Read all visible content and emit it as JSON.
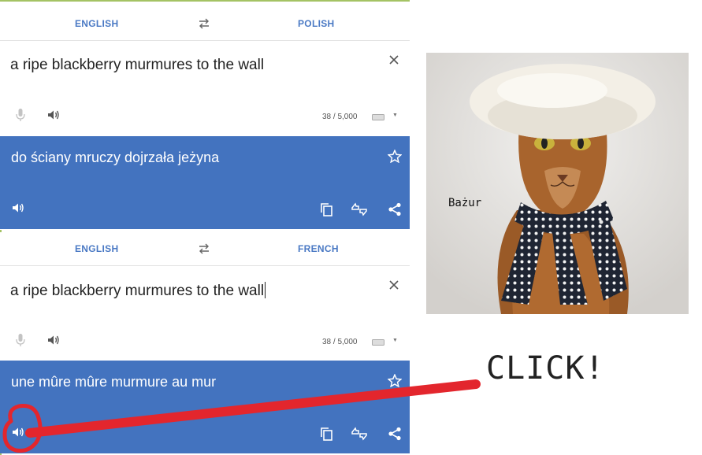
{
  "panels": [
    {
      "source_lang": "ENGLISH",
      "target_lang": "POLISH",
      "source_text": "a ripe blackberry murmures to the wall",
      "char_count": "38 / 5,000",
      "translation": "do ściany mruczy dojrzała jeżyna"
    },
    {
      "source_lang": "ENGLISH",
      "target_lang": "FRENCH",
      "source_text": "a ripe blackberry murmures to the wall",
      "char_count": "38 / 5,000",
      "translation": "une mûre mûre murmure au mur"
    }
  ],
  "photo": {
    "caption": "Bażur"
  },
  "annotation": {
    "text": "CLICK!"
  },
  "colors": {
    "accent": "#4373bf",
    "lang_text": "#4a79c4",
    "marker": "#e3262d",
    "edge": "#a4c364"
  },
  "icons": [
    "swap-icon",
    "close-icon",
    "mic-icon",
    "speaker-icon",
    "keyboard-icon",
    "star-icon",
    "copy-icon",
    "feedback-icon",
    "share-icon"
  ]
}
